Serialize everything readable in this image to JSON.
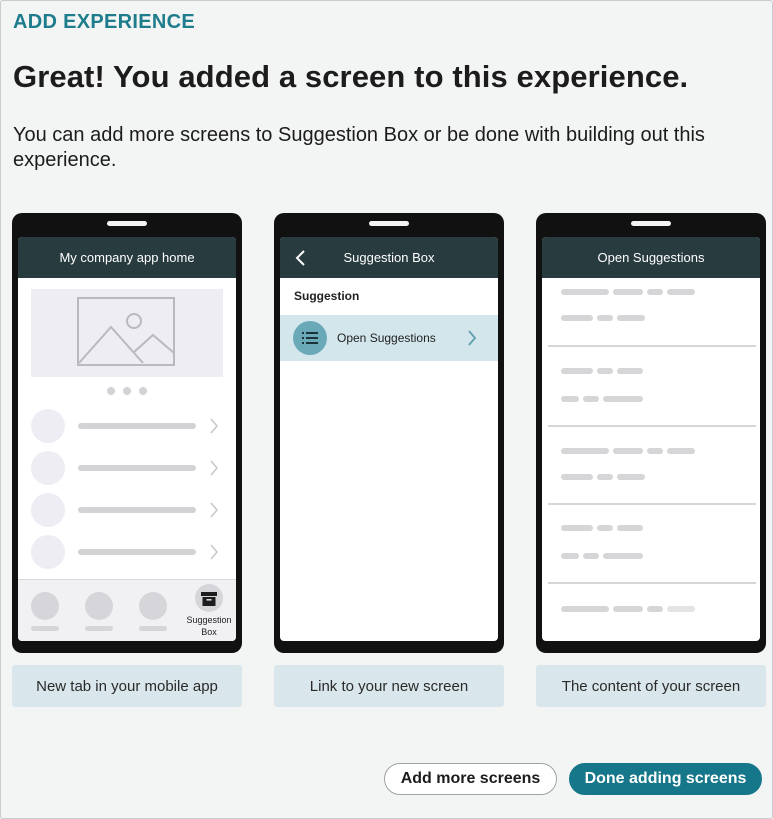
{
  "header": {
    "eyebrow": "ADD EXPERIENCE",
    "headline": "Great! You added a screen to this experience.",
    "subtext": "You can add more screens to Suggestion Box or be done with building out this experience."
  },
  "phones": [
    {
      "title": "My company app home",
      "active_tab_icon": "archive-box-icon",
      "active_tab_label": "Suggestion Box",
      "caption": "New tab in your mobile app"
    },
    {
      "title": "Suggestion Box",
      "back_icon": "chevron-left-icon",
      "section_label": "Suggestion",
      "item_icon": "list-icon",
      "item_label": "Open Suggestions",
      "caption": "Link to your new screen"
    },
    {
      "title": "Open Suggestions",
      "caption": "The content of your screen"
    }
  ],
  "actions": {
    "add_more": "Add more screens",
    "done": "Done adding screens"
  },
  "colors": {
    "accent": "#1e7d8c",
    "primary_button": "#16778a",
    "phone_header": "#283b3f",
    "caption_bg": "#d9e6eb",
    "highlight_row": "#d3e6ec"
  }
}
